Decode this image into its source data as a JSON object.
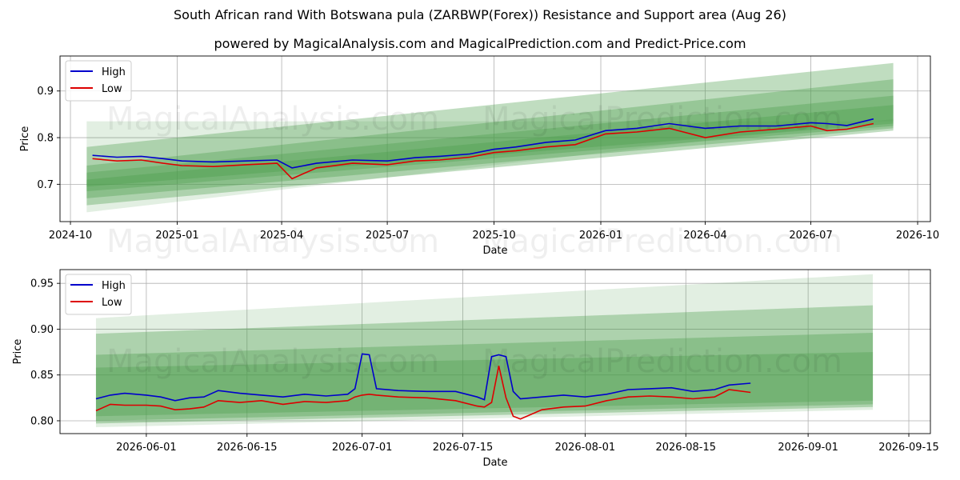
{
  "title": "South African rand With Botswana pula (ZARBWP(Forex)) Resistance and Support area (Aug 26)",
  "subtitle": "powered by MagicalAnalysis.com and MagicalPrediction.com and Predict-Price.com",
  "watermarks": [
    "MagicalAnalysis.com",
    "MagicalPrediction.com"
  ],
  "colors": {
    "high": "#0000cc",
    "low": "#dd0000",
    "band": "#4a9e4a"
  },
  "chart_data": [
    {
      "type": "line",
      "xlabel": "Date",
      "ylabel": "Price",
      "xlim": [
        "2024-09-22",
        "2026-10-12"
      ],
      "ylim": [
        0.62,
        0.975
      ],
      "xticks": [
        "2024-10",
        "2025-01",
        "2025-04",
        "2025-07",
        "2025-10",
        "2026-01",
        "2026-04",
        "2026-07",
        "2026-10"
      ],
      "xtick_dates": [
        "2024-10-01",
        "2025-01-01",
        "2025-04-01",
        "2025-07-01",
        "2025-10-01",
        "2026-01-01",
        "2026-04-01",
        "2026-07-01",
        "2026-10-01"
      ],
      "yticks": [
        0.7,
        0.8,
        0.9
      ],
      "grid": true,
      "legend": "top-left",
      "series": [
        {
          "name": "High",
          "x": [
            "2024-10-20",
            "2024-11-10",
            "2024-12-01",
            "2024-12-20",
            "2025-01-05",
            "2025-02-01",
            "2025-03-01",
            "2025-03-28",
            "2025-04-10",
            "2025-05-01",
            "2025-06-01",
            "2025-07-01",
            "2025-07-25",
            "2025-08-15",
            "2025-09-10",
            "2025-10-01",
            "2025-10-20",
            "2025-11-15",
            "2025-12-10",
            "2026-01-05",
            "2026-02-01",
            "2026-03-01",
            "2026-04-01",
            "2026-05-01",
            "2026-06-01",
            "2026-07-01",
            "2026-07-15",
            "2026-08-01",
            "2026-08-24"
          ],
          "values": [
            0.762,
            0.758,
            0.76,
            0.755,
            0.75,
            0.748,
            0.75,
            0.752,
            0.735,
            0.745,
            0.752,
            0.75,
            0.757,
            0.76,
            0.765,
            0.775,
            0.78,
            0.79,
            0.795,
            0.815,
            0.82,
            0.83,
            0.82,
            0.825,
            0.825,
            0.832,
            0.83,
            0.826,
            0.84
          ]
        },
        {
          "name": "Low",
          "x": [
            "2024-10-20",
            "2024-11-10",
            "2024-12-01",
            "2024-12-20",
            "2025-01-05",
            "2025-02-01",
            "2025-03-01",
            "2025-03-28",
            "2025-04-10",
            "2025-05-01",
            "2025-06-01",
            "2025-07-01",
            "2025-07-25",
            "2025-08-15",
            "2025-09-10",
            "2025-10-01",
            "2025-10-20",
            "2025-11-15",
            "2025-12-10",
            "2026-01-05",
            "2026-02-01",
            "2026-03-01",
            "2026-04-01",
            "2026-05-01",
            "2026-06-01",
            "2026-07-01",
            "2026-07-15",
            "2026-08-01",
            "2026-08-24"
          ],
          "values": [
            0.755,
            0.75,
            0.752,
            0.745,
            0.74,
            0.738,
            0.742,
            0.745,
            0.712,
            0.735,
            0.745,
            0.742,
            0.75,
            0.752,
            0.758,
            0.768,
            0.772,
            0.78,
            0.785,
            0.808,
            0.812,
            0.82,
            0.8,
            0.812,
            0.818,
            0.825,
            0.815,
            0.818,
            0.83
          ]
        }
      ],
      "bands": [
        {
          "x": [
            "2024-10-15",
            "2026-09-10"
          ],
          "upper": [
            0.835,
            0.835
          ],
          "lower": [
            0.64,
            0.84
          ]
        },
        {
          "x": [
            "2024-10-15",
            "2026-09-10"
          ],
          "upper": [
            0.78,
            0.96
          ],
          "lower": [
            0.655,
            0.815
          ]
        },
        {
          "x": [
            "2024-10-15",
            "2026-09-10"
          ],
          "upper": [
            0.74,
            0.925
          ],
          "lower": [
            0.67,
            0.82
          ]
        },
        {
          "x": [
            "2024-10-15",
            "2026-09-10"
          ],
          "upper": [
            0.725,
            0.89
          ],
          "lower": [
            0.685,
            0.825
          ]
        },
        {
          "x": [
            "2024-10-15",
            "2026-09-10"
          ],
          "upper": [
            0.71,
            0.87
          ],
          "lower": [
            0.695,
            0.83
          ]
        }
      ]
    },
    {
      "type": "line",
      "xlabel": "Date",
      "ylabel": "Price",
      "xlim": [
        "2026-05-20",
        "2026-09-18"
      ],
      "ylim": [
        0.786,
        0.965
      ],
      "xticks": [
        "2026-06-01",
        "2026-06-15",
        "2026-07-01",
        "2026-07-15",
        "2026-08-01",
        "2026-08-15",
        "2026-09-01",
        "2026-09-15"
      ],
      "yticks": [
        0.8,
        0.85,
        0.9,
        0.95
      ],
      "grid": true,
      "legend": "top-left",
      "series": [
        {
          "name": "High",
          "x": [
            "2026-05-25",
            "2026-05-27",
            "2026-05-29",
            "2026-06-01",
            "2026-06-03",
            "2026-06-05",
            "2026-06-07",
            "2026-06-09",
            "2026-06-11",
            "2026-06-14",
            "2026-06-17",
            "2026-06-20",
            "2026-06-23",
            "2026-06-26",
            "2026-06-29",
            "2026-06-30",
            "2026-07-01",
            "2026-07-02",
            "2026-07-03",
            "2026-07-06",
            "2026-07-10",
            "2026-07-14",
            "2026-07-17",
            "2026-07-18",
            "2026-07-19",
            "2026-07-20",
            "2026-07-21",
            "2026-07-22",
            "2026-07-23",
            "2026-07-26",
            "2026-07-29",
            "2026-08-01",
            "2026-08-04",
            "2026-08-07",
            "2026-08-10",
            "2026-08-13",
            "2026-08-16",
            "2026-08-19",
            "2026-08-21",
            "2026-08-24"
          ],
          "values": [
            0.824,
            0.828,
            0.83,
            0.828,
            0.826,
            0.822,
            0.825,
            0.826,
            0.833,
            0.83,
            0.828,
            0.826,
            0.829,
            0.827,
            0.829,
            0.835,
            0.873,
            0.872,
            0.835,
            0.833,
            0.832,
            0.832,
            0.826,
            0.823,
            0.87,
            0.872,
            0.87,
            0.832,
            0.824,
            0.826,
            0.828,
            0.826,
            0.829,
            0.834,
            0.835,
            0.836,
            0.832,
            0.834,
            0.839,
            0.841
          ]
        },
        {
          "name": "Low",
          "x": [
            "2026-05-25",
            "2026-05-27",
            "2026-05-29",
            "2026-06-01",
            "2026-06-03",
            "2026-06-05",
            "2026-06-07",
            "2026-06-09",
            "2026-06-11",
            "2026-06-14",
            "2026-06-17",
            "2026-06-20",
            "2026-06-23",
            "2026-06-26",
            "2026-06-29",
            "2026-06-30",
            "2026-07-01",
            "2026-07-02",
            "2026-07-03",
            "2026-07-06",
            "2026-07-10",
            "2026-07-14",
            "2026-07-17",
            "2026-07-18",
            "2026-07-19",
            "2026-07-20",
            "2026-07-21",
            "2026-07-22",
            "2026-07-23",
            "2026-07-26",
            "2026-07-29",
            "2026-08-01",
            "2026-08-04",
            "2026-08-07",
            "2026-08-10",
            "2026-08-13",
            "2026-08-16",
            "2026-08-19",
            "2026-08-21",
            "2026-08-24"
          ],
          "values": [
            0.811,
            0.818,
            0.817,
            0.817,
            0.816,
            0.812,
            0.813,
            0.815,
            0.822,
            0.82,
            0.822,
            0.818,
            0.821,
            0.82,
            0.822,
            0.826,
            0.828,
            0.829,
            0.828,
            0.826,
            0.825,
            0.822,
            0.816,
            0.815,
            0.82,
            0.86,
            0.825,
            0.805,
            0.802,
            0.812,
            0.815,
            0.816,
            0.822,
            0.826,
            0.827,
            0.826,
            0.824,
            0.826,
            0.834,
            0.831
          ]
        }
      ],
      "bands": [
        {
          "x": [
            "2026-05-25",
            "2026-09-10"
          ],
          "upper": [
            0.912,
            0.96
          ],
          "lower": [
            0.793,
            0.812
          ]
        },
        {
          "x": [
            "2026-05-25",
            "2026-09-10"
          ],
          "upper": [
            0.895,
            0.926
          ],
          "lower": [
            0.797,
            0.815
          ]
        },
        {
          "x": [
            "2026-05-25",
            "2026-09-10"
          ],
          "upper": [
            0.872,
            0.896
          ],
          "lower": [
            0.8,
            0.818
          ]
        },
        {
          "x": [
            "2026-05-25",
            "2026-09-10"
          ],
          "upper": [
            0.858,
            0.875
          ],
          "lower": [
            0.805,
            0.822
          ]
        }
      ]
    }
  ]
}
